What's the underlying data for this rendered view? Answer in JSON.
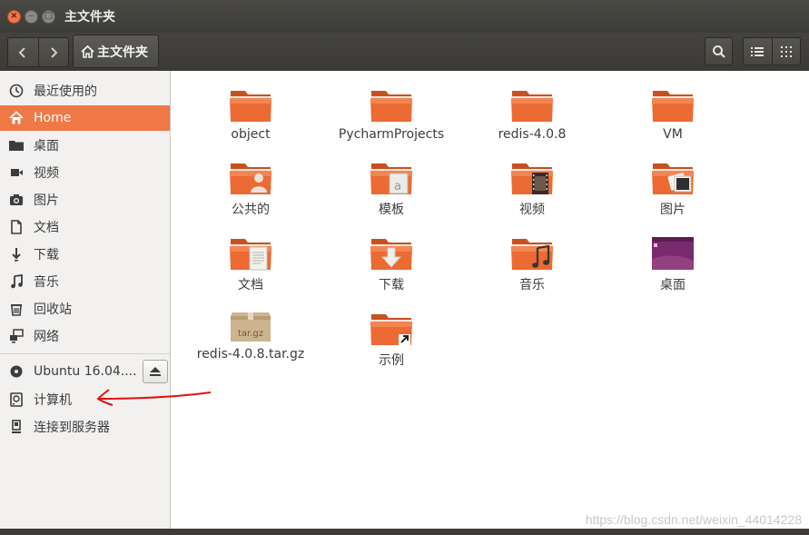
{
  "window": {
    "title": "主文件夹"
  },
  "toolbar": {
    "breadcrumb": "主文件夹",
    "back_icon": "chevron-left-icon",
    "forward_icon": "chevron-right-icon",
    "search_icon": "search-icon",
    "list_view_icon": "list-icon",
    "grid_view_icon": "grid-icon"
  },
  "sidebar": {
    "items": [
      {
        "label": "最近使用的",
        "icon": "clock-icon"
      },
      {
        "label": "Home",
        "icon": "home-icon",
        "active": true
      },
      {
        "label": "桌面",
        "icon": "folder-icon"
      },
      {
        "label": "视频",
        "icon": "video-icon"
      },
      {
        "label": "图片",
        "icon": "camera-icon"
      },
      {
        "label": "文档",
        "icon": "document-icon"
      },
      {
        "label": "下载",
        "icon": "download-icon"
      },
      {
        "label": "音乐",
        "icon": "music-icon"
      },
      {
        "label": "回收站",
        "icon": "trash-icon"
      },
      {
        "label": "网络",
        "icon": "network-icon"
      }
    ],
    "devices": [
      {
        "label": "Ubuntu 16.04....",
        "icon": "disc-icon"
      },
      {
        "label": "计算机",
        "icon": "drive-icon"
      },
      {
        "label": "连接到服务器",
        "icon": "server-icon"
      }
    ]
  },
  "files": [
    {
      "name": "object",
      "kind": "folder"
    },
    {
      "name": "PycharmProjects",
      "kind": "folder"
    },
    {
      "name": "redis-4.0.8",
      "kind": "folder"
    },
    {
      "name": "VM",
      "kind": "folder"
    },
    {
      "name": "公共的",
      "kind": "folder-public"
    },
    {
      "name": "模板",
      "kind": "folder-templates"
    },
    {
      "name": "视频",
      "kind": "folder-videos"
    },
    {
      "name": "图片",
      "kind": "folder-pictures"
    },
    {
      "name": "文档",
      "kind": "folder-documents"
    },
    {
      "name": "下载",
      "kind": "folder-downloads"
    },
    {
      "name": "音乐",
      "kind": "folder-music"
    },
    {
      "name": "桌面",
      "kind": "folder-desktop"
    },
    {
      "name": "redis-4.0.8.tar.gz",
      "kind": "archive",
      "badge": "tar.gz"
    },
    {
      "name": "示例",
      "kind": "folder-link"
    }
  ],
  "watermark": "https://blog.csdn.net/weixin_44014228",
  "colors": {
    "accent": "#f07746",
    "folder": "#e9622f",
    "titlebar": "#3c3b37"
  }
}
